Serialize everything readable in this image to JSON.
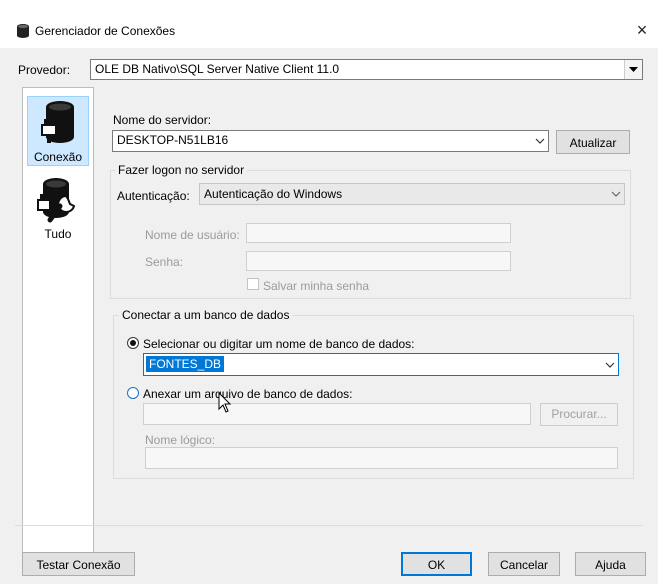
{
  "window": {
    "title": "Gerenciador de Conexões",
    "close_icon": "×"
  },
  "provider": {
    "label": "Provedor:",
    "value": "OLE DB Nativo\\SQL Server Native Client 11.0"
  },
  "sidebar": {
    "items": [
      {
        "label": "Conexão",
        "icon": "database-plug-icon",
        "selected": true
      },
      {
        "label": "Tudo",
        "icon": "database-wrench-icon",
        "selected": false
      }
    ]
  },
  "server": {
    "label": "Nome do servidor:",
    "value": "DESKTOP-N51LB16",
    "refresh_label": "Atualizar"
  },
  "logon": {
    "group_title": "Fazer logon no servidor",
    "auth_label": "Autenticação:",
    "auth_value": "Autenticação do Windows",
    "username_label": "Nome de usuário:",
    "password_label": "Senha:",
    "save_password_label": "Salvar minha senha"
  },
  "database": {
    "group_title": "Conectar a um banco de dados",
    "select_option_label": "Selecionar ou digitar um nome de banco de dados:",
    "select_value": "FONTES_DB",
    "attach_option_label": "Anexar um arquivo de banco de dados:",
    "browse_label": "Procurar...",
    "logical_name_label": "Nome lógico:"
  },
  "footer": {
    "test_label": "Testar Conexão",
    "ok_label": "OK",
    "cancel_label": "Cancelar",
    "help_label": "Ajuda"
  },
  "colors": {
    "selection": "#0078d7",
    "sidebar_selected": "#cde8ff"
  }
}
